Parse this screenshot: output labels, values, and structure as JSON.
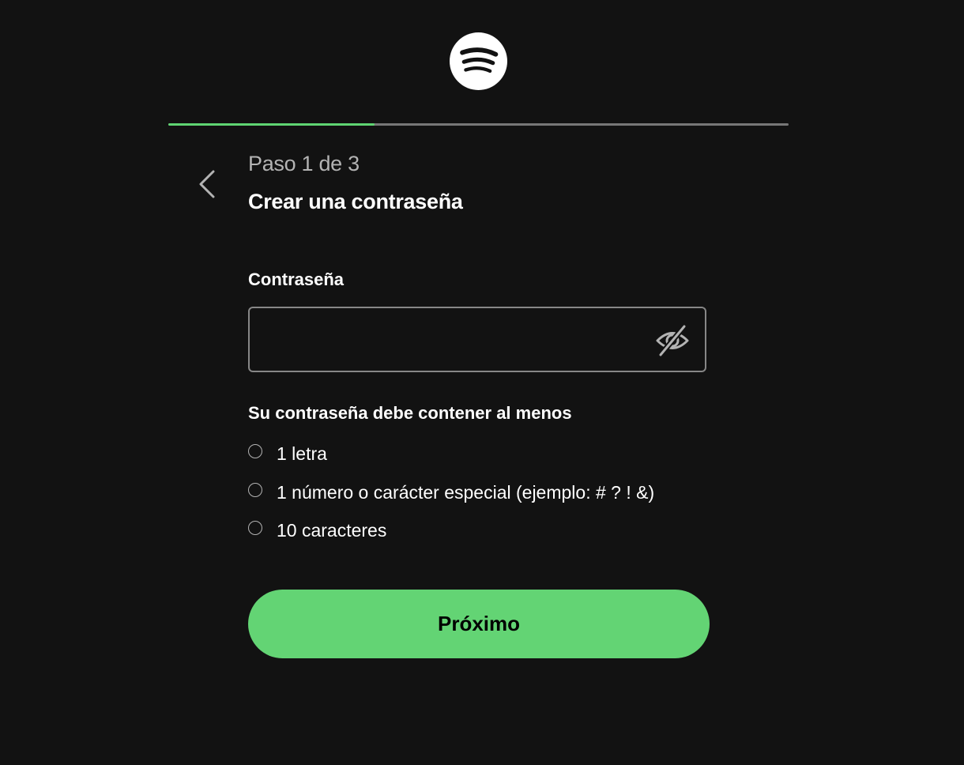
{
  "brand": {
    "logo_icon": "spotify-logo-icon",
    "logo_color": "#ffffff",
    "logo_bar_color": "#121212"
  },
  "progress": {
    "current_step": 1,
    "total_steps": 3,
    "fill_fraction": 0.333,
    "fill_color": "#5fd472",
    "track_color": "#777777"
  },
  "header": {
    "back_icon": "chevron-left-icon",
    "step_label": "Paso 1 de 3",
    "title": "Crear una contraseña"
  },
  "form": {
    "password_label": "Contraseña",
    "password_value": "",
    "visibility_icon": "eye-slash-icon"
  },
  "requirements": {
    "title": "Su contraseña debe contener al menos",
    "items": [
      {
        "label": "1 letra",
        "met": false
      },
      {
        "label": "1 número o carácter especial (ejemplo: # ? ! &)",
        "met": false
      },
      {
        "label": "10 caracteres",
        "met": false
      }
    ]
  },
  "actions": {
    "next_label": "Próximo",
    "next_color": "#63d474"
  },
  "colors": {
    "background": "#121212",
    "text_primary": "#ffffff",
    "text_secondary": "#b3b3b3"
  }
}
